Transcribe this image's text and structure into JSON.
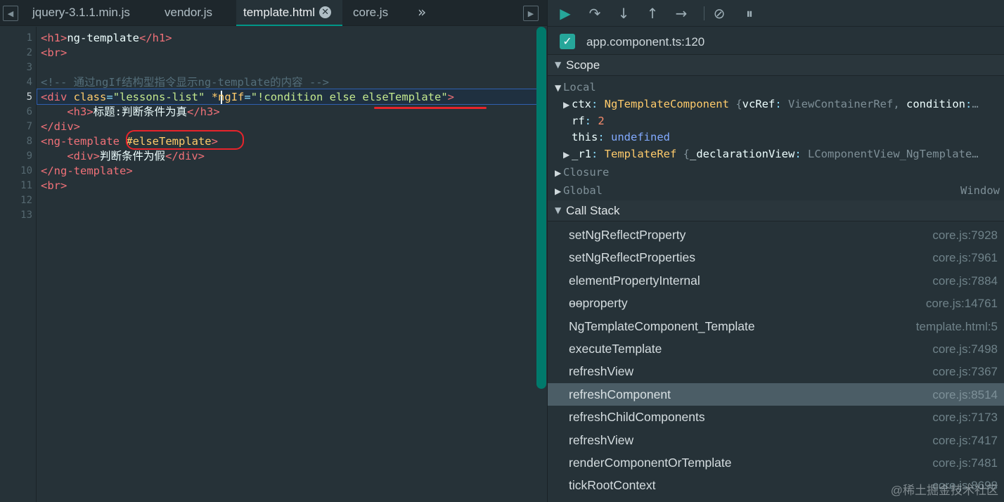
{
  "tabs": {
    "items": [
      {
        "label": "jquery-3.1.1.min.js",
        "active": false
      },
      {
        "label": "vendor.js",
        "active": false
      },
      {
        "label": "template.html",
        "active": true
      },
      {
        "label": "core.js",
        "active": false
      }
    ],
    "close_glyph": "✕",
    "more_glyph": "»",
    "nav_left_icon": "panel-left-icon",
    "nav_right_icon": "panel-right-icon"
  },
  "editor": {
    "line_numbers": [
      "1",
      "2",
      "3",
      "4",
      "5",
      "6",
      "7",
      "8",
      "9",
      "10",
      "11",
      "12",
      "13"
    ],
    "current_line": 5,
    "lines": {
      "l1": {
        "open": "<h1>",
        "text": "ng-template",
        "close": "</h1>"
      },
      "l2": {
        "tag": "<br>"
      },
      "l4": {
        "comment": "<!-- 通过ngIf结构型指令显示ng-template的内容 -->"
      },
      "l5": {
        "open": "<div",
        "attr1": "class",
        "eq1": "=",
        "val1": "\"lessons-list\"",
        "star": "*",
        "attr2": "ngIf",
        "eq2": "=",
        "val2": "\"!condition else elseTemplate\"",
        "end": ">"
      },
      "l6": {
        "indent": "    ",
        "open": "<h3>",
        "text": "标题:判断条件为真",
        "close": "</h3>"
      },
      "l7": {
        "close": "</div>"
      },
      "l8": {
        "open": "<ng-template",
        "ref": "#elseTemplate",
        "end": ">"
      },
      "l9": {
        "indent": "    ",
        "open": "<div>",
        "text": "判断条件为假",
        "close": "</div>"
      },
      "l10": {
        "close": "</ng-template>"
      },
      "l11": {
        "tag": "<br>"
      }
    }
  },
  "debugger": {
    "toolbar": {
      "resume_icon": "▶",
      "step_over_icon": "↷",
      "step_into_icon": "↓",
      "step_out_icon": "↑",
      "step_icon": "→",
      "deactivate_icon": "⊘",
      "pause_icon": "⏸"
    },
    "breakpoint": {
      "checked_glyph": "✓",
      "label": "app.component.ts:120"
    },
    "scope": {
      "title": "Scope",
      "arrow_open": "▼",
      "arrow_closed": "▶",
      "local_label": "Local",
      "ctx": {
        "key": "ctx",
        "cls": "NgTemplateComponent",
        "rest_open": "{",
        "k1": "vcRef",
        "v1": "ViewContainerRef",
        "k2": "condition",
        "tail": "…"
      },
      "rf": {
        "key": "rf",
        "value": "2"
      },
      "this_row": {
        "key": "this",
        "value": "undefined"
      },
      "r1": {
        "key": "_r1",
        "cls": "TemplateRef",
        "rest_open": "{",
        "k1": "_declarationView",
        "v1": "LComponentView_NgTemplate…"
      },
      "closure_label": "Closure",
      "global_label": "Global",
      "global_value": "Window"
    },
    "call_stack": {
      "title": "Call Stack",
      "frames": [
        {
          "fn": "setNgReflectProperty",
          "loc": "core.js:7928"
        },
        {
          "fn": "setNgReflectProperties",
          "loc": "core.js:7961"
        },
        {
          "fn": "elementPropertyInternal",
          "loc": "core.js:7884"
        },
        {
          "fn": "ɵɵproperty",
          "loc": "core.js:14761"
        },
        {
          "fn": "NgTemplateComponent_Template",
          "loc": "template.html:5"
        },
        {
          "fn": "executeTemplate",
          "loc": "core.js:7498"
        },
        {
          "fn": "refreshView",
          "loc": "core.js:7367"
        },
        {
          "fn": "refreshComponent",
          "loc": "core.js:8514"
        },
        {
          "fn": "refreshChildComponents",
          "loc": "core.js:7173"
        },
        {
          "fn": "refreshView",
          "loc": "core.js:7417"
        },
        {
          "fn": "renderComponentOrTemplate",
          "loc": "core.js:7481"
        },
        {
          "fn": "tickRootContext",
          "loc": "core.js:8698"
        }
      ],
      "selected_index": 7
    }
  },
  "watermark": "@稀土掘金技术社区",
  "colors": {
    "accent": "#26a69a",
    "annotation_red": "#e8242b",
    "selection_blue": "#2f5fb0"
  }
}
